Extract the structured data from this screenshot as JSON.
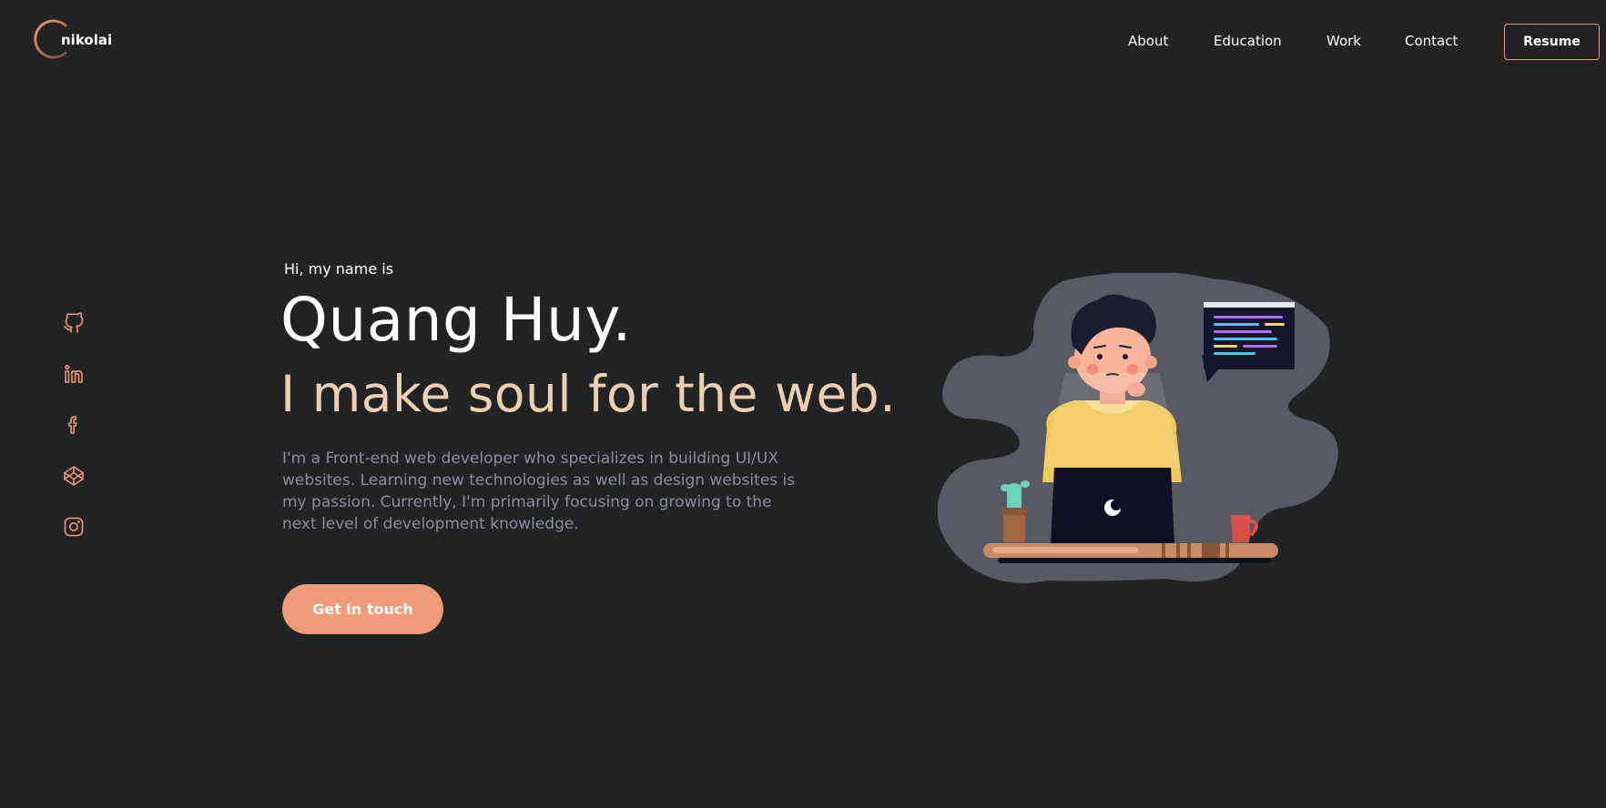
{
  "header": {
    "logo_text": "nikolai",
    "nav": [
      {
        "label": "About"
      },
      {
        "label": "Education"
      },
      {
        "label": "Work"
      },
      {
        "label": "Contact"
      }
    ],
    "resume_label": "Resume"
  },
  "social": [
    {
      "icon": "github-icon"
    },
    {
      "icon": "linkedin-icon"
    },
    {
      "icon": "facebook-icon"
    },
    {
      "icon": "codepen-icon"
    },
    {
      "icon": "instagram-icon"
    }
  ],
  "hero": {
    "greeting": "Hi, my name is",
    "name": "Quang Huy.",
    "tagline": "I make soul for the web.",
    "bio": "I'm a Front-end web developer who specializes in building UI/UX websites. Learning new technologies as well as design websites is my passion. Currently, I'm primarily focusing on growing to the next level of development knowledge.",
    "cta_label": "Get in touch"
  },
  "colors": {
    "background": "#222325",
    "accent": "#ef9b7a",
    "tagline": "#eccfb0",
    "muted_text": "#8b8c9e"
  }
}
